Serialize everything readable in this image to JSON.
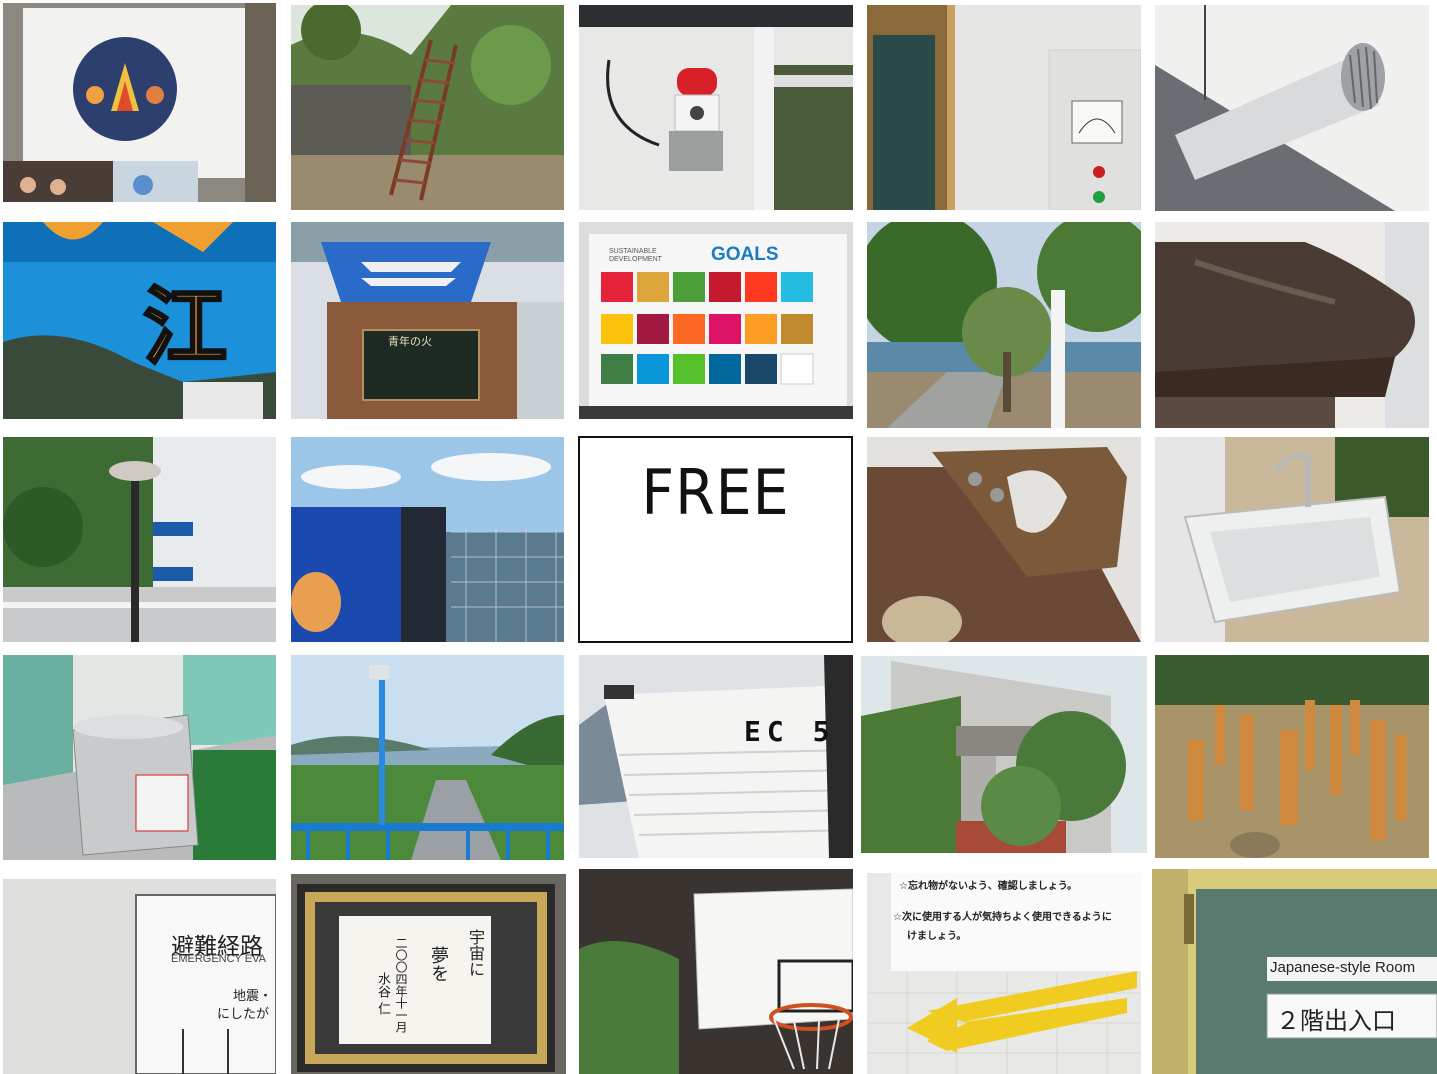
{
  "grid": {
    "free_label": "FREE",
    "tiles": [
      {
        "name": "campfire-poster-photo"
      },
      {
        "name": "hillside-staircase-photo"
      },
      {
        "name": "rotating-warning-light-photo"
      },
      {
        "name": "wall-meter-panel-photo"
      },
      {
        "name": "exhaust-pipe-photo"
      },
      {
        "name": "blue-sign-closeup-photo",
        "text": "江"
      },
      {
        "name": "youth-fire-monument-photo",
        "plaque_title": "青年の火"
      },
      {
        "name": "sdgs-poster-photo",
        "title_small": "SUSTAINABLE DEVELOPMENT",
        "title_big": "GOALS"
      },
      {
        "name": "olive-tree-path-photo"
      },
      {
        "name": "old-boot-photo"
      },
      {
        "name": "lamp-post-building-photo"
      },
      {
        "name": "mascot-fence-sea-view-photo"
      },
      {
        "name": "free-space"
      },
      {
        "name": "hand-saw-photo"
      },
      {
        "name": "outdoor-sink-photo"
      },
      {
        "name": "drinking-fountain-photo"
      },
      {
        "name": "campus-view-light-pole-photo"
      },
      {
        "name": "boat-hull-photo",
        "text": "EC 5"
      },
      {
        "name": "ruined-building-photo"
      },
      {
        "name": "wooden-posts-field-photo"
      },
      {
        "name": "evacuation-sign-photo",
        "title": "避難経路",
        "subtitle": "EMERGENCY EVA",
        "line1": "地震・",
        "line2": "にしたが"
      },
      {
        "name": "framed-calligraphy-photo",
        "col1": "宇宙に",
        "col2": "夢を",
        "col3": "二〇〇四年十一月",
        "col4": "水谷 仁"
      },
      {
        "name": "basketball-hoop-photo"
      },
      {
        "name": "lost-items-notice-photo",
        "line1": "☆忘れ物がないよう、確認しましょう。",
        "line2": "☆次に使用する人が気持ちよく使用できるように",
        "line3": "けましょう。"
      },
      {
        "name": "japanese-style-room-sign-photo",
        "line1": "Japanese-style Room",
        "line2": "２階出入口"
      }
    ]
  }
}
